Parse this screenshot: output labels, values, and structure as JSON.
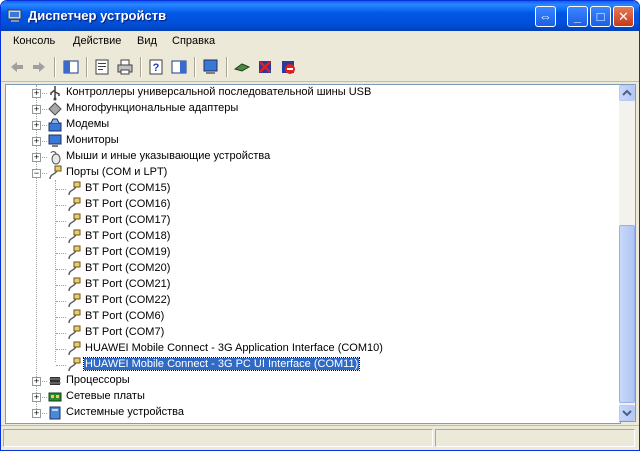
{
  "window": {
    "title": "Диспетчер устройств",
    "title_icon": "computer-icon",
    "controls": {
      "restore": "⇔",
      "minimize": "_",
      "maximize": "□",
      "close": "✕"
    }
  },
  "menu": [
    "Консоль",
    "Действие",
    "Вид",
    "Справка"
  ],
  "toolbar": {
    "buttons": [
      "back-icon",
      "forward-icon",
      "console-tree-icon",
      "properties-icon",
      "print-icon",
      "help-icon",
      "show-hide-icon",
      "scan-hardware-icon",
      "update-driver-icon",
      "uninstall-icon",
      "disable-icon"
    ]
  },
  "tree": {
    "categories_top": [
      {
        "label": "Контроллеры универсальной последовательной шины USB",
        "icon": "usb-icon",
        "expander": "+"
      },
      {
        "label": "Многофункциональные адаптеры",
        "icon": "multifunction-icon",
        "expander": "+"
      },
      {
        "label": "Модемы",
        "icon": "modem-icon",
        "expander": "+"
      },
      {
        "label": "Мониторы",
        "icon": "monitor-icon",
        "expander": "+"
      },
      {
        "label": "Мыши и иные указывающие устройства",
        "icon": "mouse-icon",
        "expander": "+"
      },
      {
        "label": "Порты (COM и LPT)",
        "icon": "port-icon",
        "expander": "−"
      }
    ],
    "ports": [
      "BT Port (COM15)",
      "BT Port (COM16)",
      "BT Port (COM17)",
      "BT Port (COM18)",
      "BT Port (COM19)",
      "BT Port (COM20)",
      "BT Port (COM21)",
      "BT Port (COM22)",
      "BT Port (COM6)",
      "BT Port (COM7)",
      "HUAWEI Mobile Connect - 3G Application Interface (COM10)",
      "HUAWEI Mobile Connect - 3G PC UI Interface (COM11)"
    ],
    "selected_port_index": 11,
    "categories_bottom": [
      {
        "label": "Процессоры",
        "icon": "processor-icon",
        "expander": "+"
      },
      {
        "label": "Сетевые платы",
        "icon": "network-card-icon",
        "expander": "+"
      },
      {
        "label": "Системные устройства",
        "icon": "system-device-icon",
        "expander": "+"
      }
    ]
  },
  "colors": {
    "selection": "#316ac5",
    "titlebar": "#0058e7"
  }
}
